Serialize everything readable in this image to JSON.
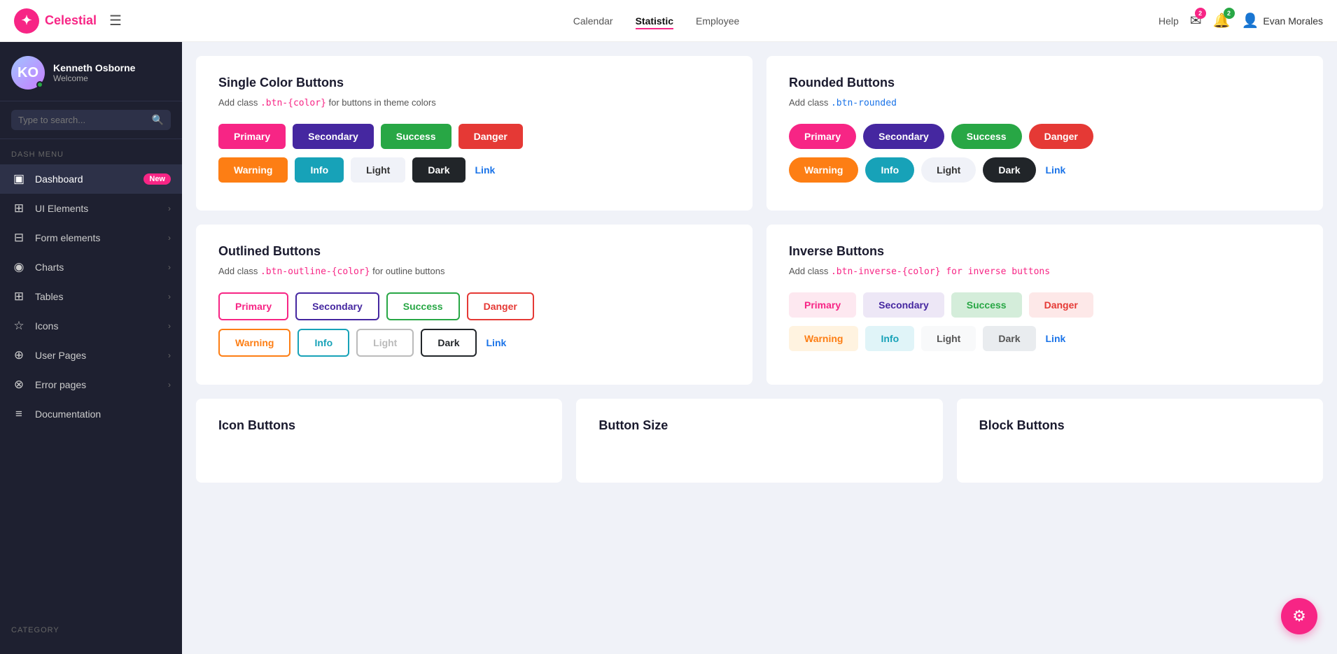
{
  "brand": {
    "name": "Celestial",
    "logo_char": "✦"
  },
  "topnav": {
    "links": [
      {
        "label": "Calendar",
        "active": false
      },
      {
        "label": "Statistic",
        "active": true
      },
      {
        "label": "Employee",
        "active": false
      }
    ],
    "help": "Help",
    "msg_badge": "2",
    "bell_badge": "2",
    "user": "Evan Morales"
  },
  "sidebar": {
    "user": {
      "name": "Kenneth Osborne",
      "role": "Welcome"
    },
    "search_placeholder": "Type to search...",
    "section_label": "Dash menu",
    "items": [
      {
        "label": "Dashboard",
        "badge": "New",
        "icon": "▣"
      },
      {
        "label": "UI Elements",
        "arrow": true,
        "icon": "⊞"
      },
      {
        "label": "Form elements",
        "arrow": true,
        "icon": "⊟"
      },
      {
        "label": "Charts",
        "arrow": true,
        "icon": "◉"
      },
      {
        "label": "Tables",
        "arrow": true,
        "icon": "⊞"
      },
      {
        "label": "Icons",
        "arrow": true,
        "icon": "☆"
      },
      {
        "label": "User Pages",
        "arrow": true,
        "icon": "⊕"
      },
      {
        "label": "Error pages",
        "arrow": true,
        "icon": "⊗"
      },
      {
        "label": "Documentation",
        "icon": "≡"
      }
    ],
    "bottom_label": "Category"
  },
  "single_color": {
    "title": "Single Color Buttons",
    "desc_prefix": "Add class ",
    "desc_code": ".btn-{color}",
    "desc_suffix": " for buttons in theme colors",
    "row1": [
      "Primary",
      "Secondary",
      "Success",
      "Danger"
    ],
    "row2": [
      "Warning",
      "Info",
      "Light",
      "Dark",
      "Link"
    ]
  },
  "rounded_buttons": {
    "title": "Rounded Buttons",
    "desc_prefix": "Add class ",
    "desc_code": ".btn-rounded",
    "desc_suffix": "",
    "row1": [
      "Primary",
      "Secondary",
      "Success",
      "Danger"
    ],
    "row2": [
      "Warning",
      "Info",
      "Light",
      "Dark",
      "Link"
    ]
  },
  "outlined": {
    "title": "Outlined Buttons",
    "desc_prefix": "Add class ",
    "desc_code": ".btn-outline-{color}",
    "desc_suffix": " for outline buttons",
    "row1": [
      "Primary",
      "Secondary",
      "Success",
      "Danger"
    ],
    "row2": [
      "Warning",
      "Info",
      "Light",
      "Dark",
      "Link"
    ]
  },
  "inverse": {
    "title": "Inverse Buttons",
    "desc_prefix": "Add class ",
    "desc_code": ".btn-inverse-{color} for inverse buttons",
    "desc_suffix": "",
    "row1": [
      "Primary",
      "Secondary",
      "Success",
      "Danger"
    ],
    "row2": [
      "Warning",
      "Info",
      "Light",
      "Dark",
      "Link"
    ]
  },
  "icon_buttons": {
    "title": "Icon Buttons"
  },
  "button_size": {
    "title": "Button Size"
  },
  "block_buttons": {
    "title": "Block Buttons"
  },
  "fab": {
    "icon": "⚙"
  }
}
